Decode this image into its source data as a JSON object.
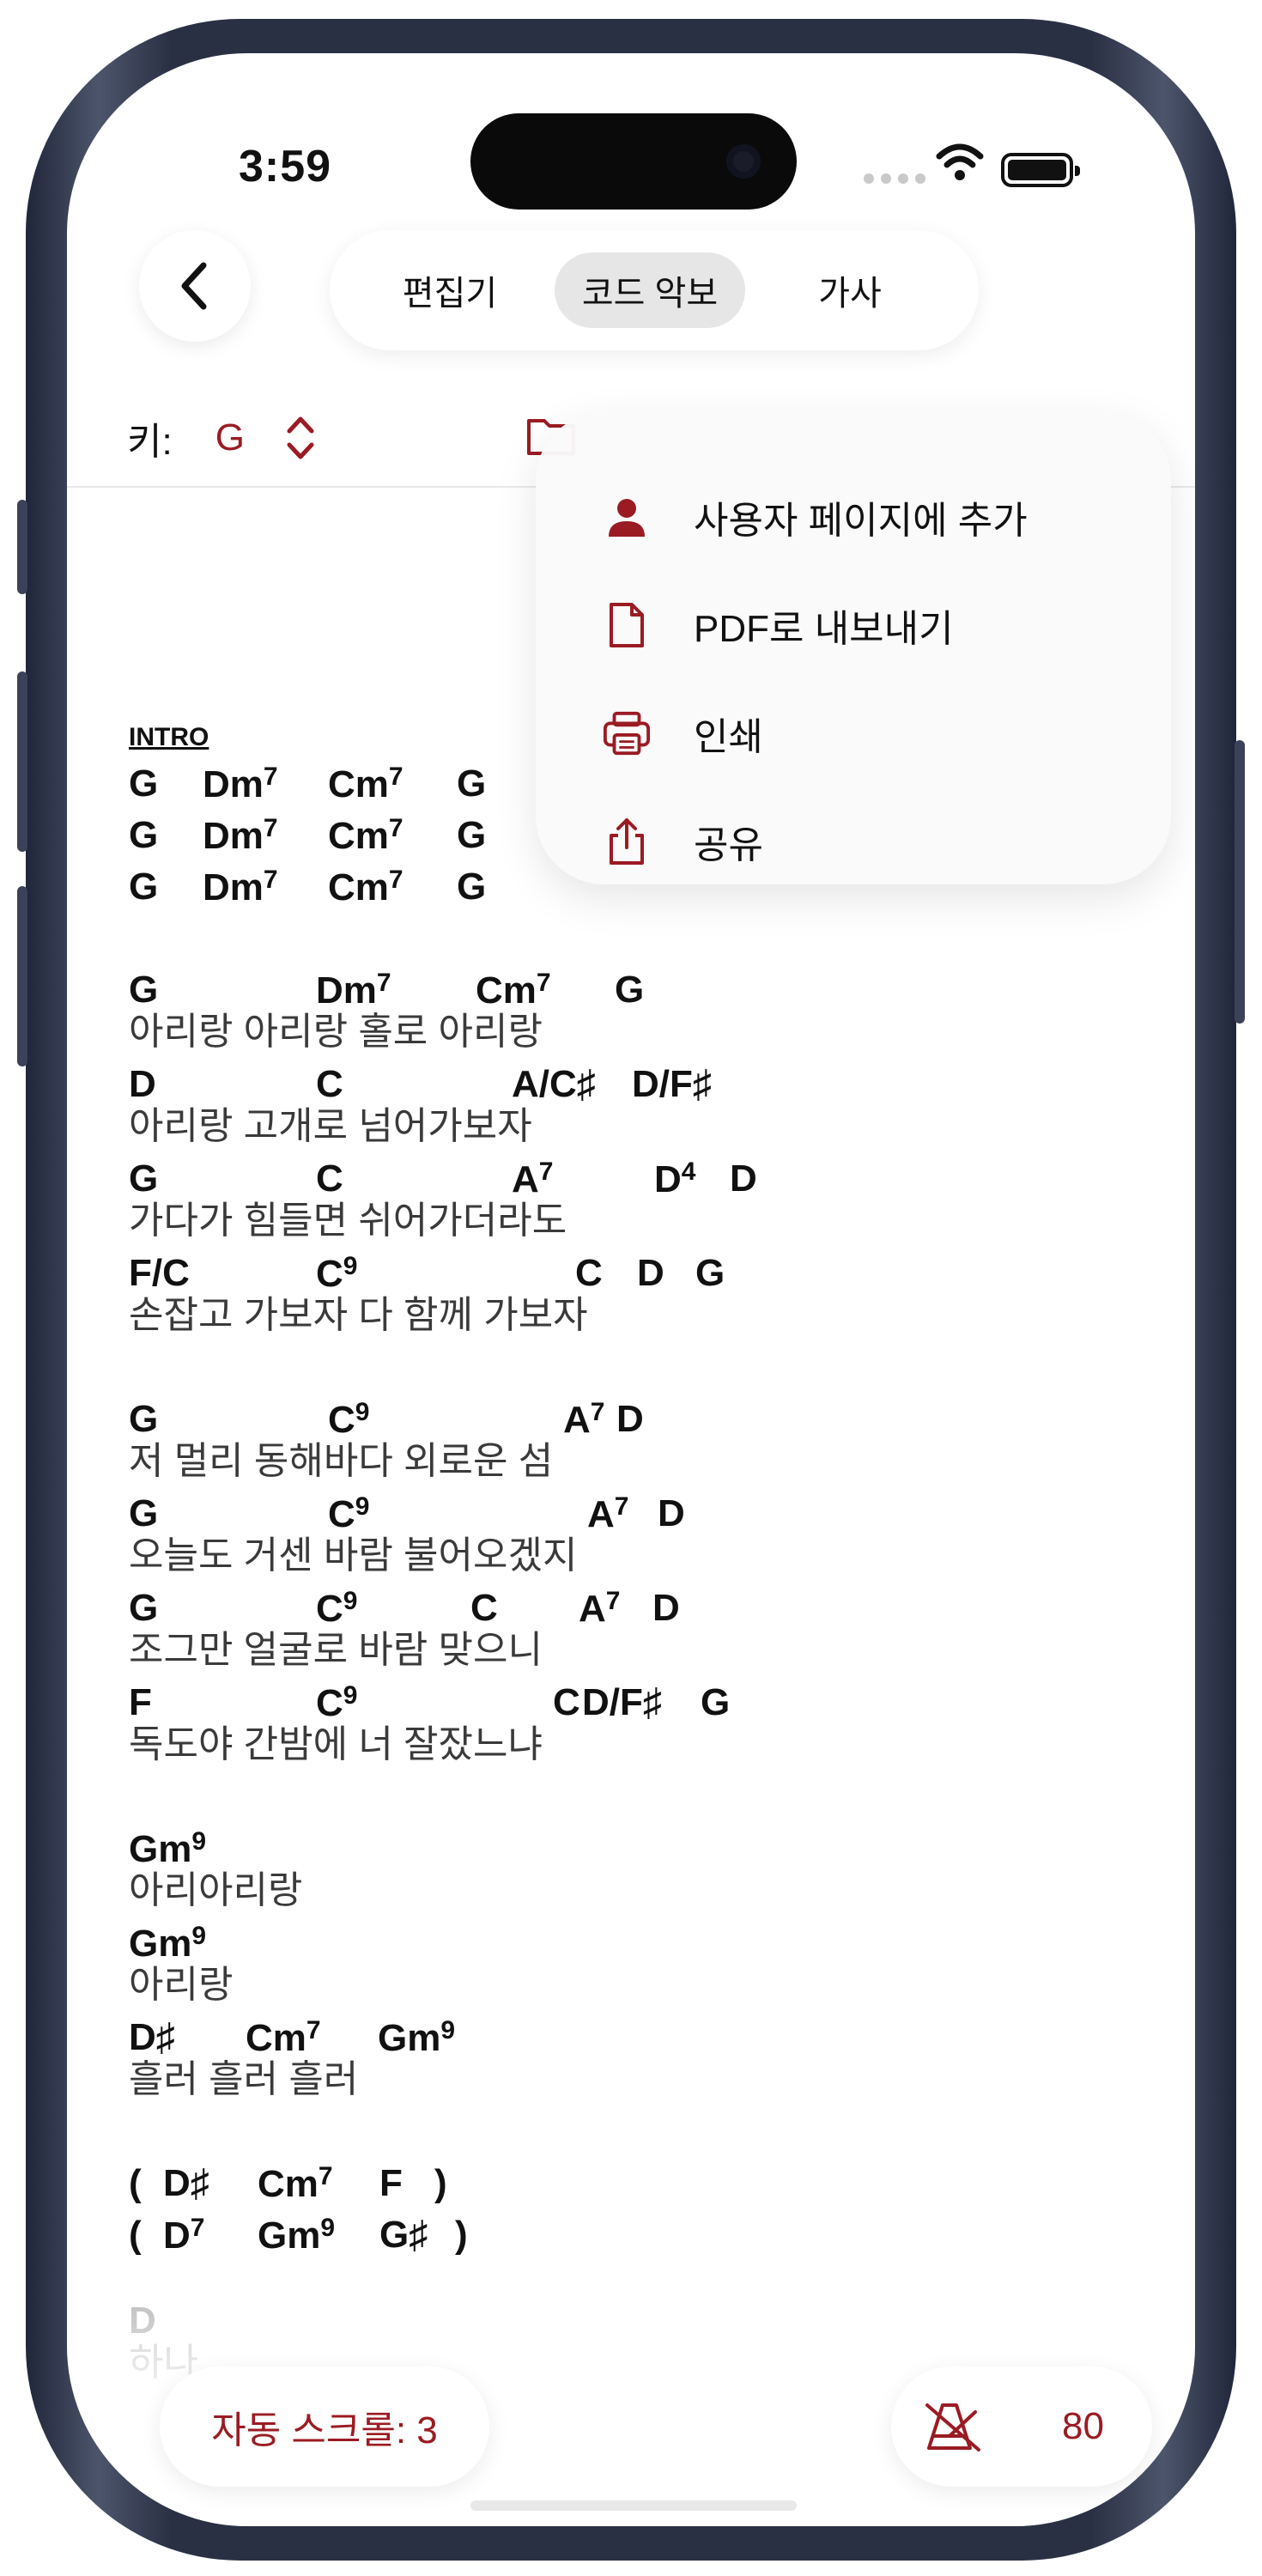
{
  "status": {
    "time": "3:59"
  },
  "header": {
    "tabs": [
      {
        "label": "편집기"
      },
      {
        "label": "코드 악보",
        "active": true
      },
      {
        "label": "가사"
      }
    ]
  },
  "key": {
    "label": "키:",
    "value": "G"
  },
  "menu": {
    "items": [
      {
        "label": "사용자 페이지에 추가",
        "icon": "person-icon"
      },
      {
        "label": "PDF로 내보내기",
        "icon": "document-icon"
      },
      {
        "label": "인쇄",
        "icon": "printer-icon"
      },
      {
        "label": "공유",
        "icon": "share-icon"
      }
    ]
  },
  "sheet": {
    "intro_label": "INTRO",
    "intro_rows": [
      [
        "G",
        "Dm",
        "Cm",
        "G"
      ],
      [
        "G",
        "Dm",
        "Cm",
        "G"
      ],
      [
        "G",
        "Dm",
        "Cm",
        "G"
      ]
    ],
    "verse1": [
      {
        "chords": [
          "G",
          "Dm",
          "Cm",
          "G"
        ],
        "lyric": "아리랑 아리랑 홀로 아리랑"
      },
      {
        "chords": [
          "D",
          "C",
          "A/C♯",
          "D/F♯"
        ],
        "lyric": "아리랑 고개로 넘어가보자"
      },
      {
        "chords": [
          "G",
          "C",
          "A",
          "D",
          "D"
        ],
        "lyric": "가다가 힘들면 쉬어가더라도"
      },
      {
        "chords": [
          "F/C",
          "C",
          "C",
          "D",
          "G"
        ],
        "lyric": "손잡고 가보자 다 함께 가보자"
      }
    ],
    "verse2": [
      {
        "chords": [
          "G",
          "C",
          "A",
          "D"
        ],
        "lyric": "저 멀리 동해바다 외로운 섬"
      },
      {
        "chords": [
          "G",
          "C",
          "A",
          "D"
        ],
        "lyric": "오늘도 거센 바람 불어오겠지"
      },
      {
        "chords": [
          "G",
          "C",
          "C",
          "A",
          "D"
        ],
        "lyric": "조그만 얼굴로 바람 맞으니"
      },
      {
        "chords": [
          "F",
          "C",
          "C",
          "D/F♯",
          "G"
        ],
        "lyric": "독도야 간밤에 너 잘잤느냐"
      }
    ],
    "bridge": [
      {
        "chords": [
          "Gm"
        ],
        "lyric": "아리아리랑"
      },
      {
        "chords": [
          "Gm"
        ],
        "lyric": "아리랑"
      },
      {
        "chords": [
          "D♯",
          "Cm",
          "Gm"
        ],
        "lyric": "흘러 흘러 흘러"
      }
    ],
    "outro_rows": [
      [
        "(",
        "D♯",
        "Cm",
        "F",
        ")"
      ],
      [
        "(",
        "D",
        "Gm",
        "G♯",
        ")"
      ]
    ],
    "tail_chord": "D",
    "tail_lyric": "하나"
  },
  "sup": {
    "seven": "7",
    "nine": "9",
    "four": "4"
  },
  "controls": {
    "autoscroll": "자동 스크롤: 3",
    "tempo": "80"
  },
  "colors": {
    "accent": "#9b1b23",
    "text": "#111111"
  }
}
